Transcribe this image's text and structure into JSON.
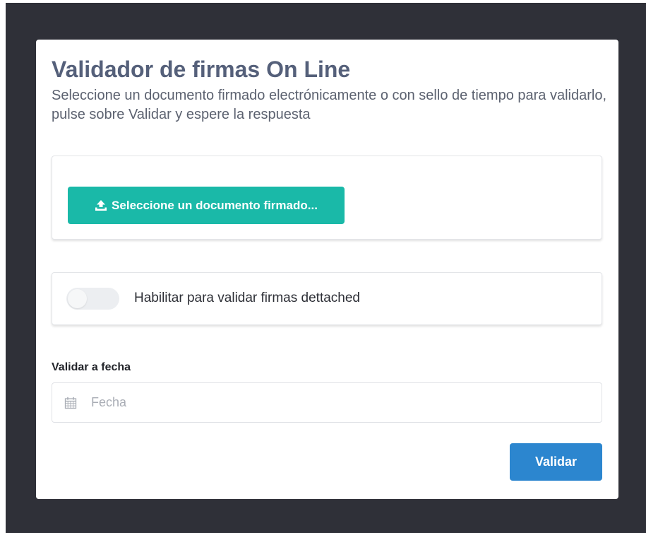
{
  "page": {
    "title": "Validador de firmas On Line",
    "subtitle": "Seleccione un documento firmado electrónicamente o con sello de tiempo para validarlo, pulse sobre Validar y espere la respuesta"
  },
  "upload": {
    "button_label": "Seleccione un documento firmado...",
    "icon": "upload-icon"
  },
  "detached": {
    "toggle_label": "Habilitar para validar firmas dettached",
    "enabled": false
  },
  "date": {
    "label": "Validar a fecha",
    "placeholder": "Fecha",
    "value": "",
    "icon": "calendar-icon"
  },
  "actions": {
    "validate_label": "Validar"
  },
  "colors": {
    "backdrop": "#2f3038",
    "title": "#55607a",
    "upload_button": "#1ab9a8",
    "validate_button": "#2c86cf"
  }
}
